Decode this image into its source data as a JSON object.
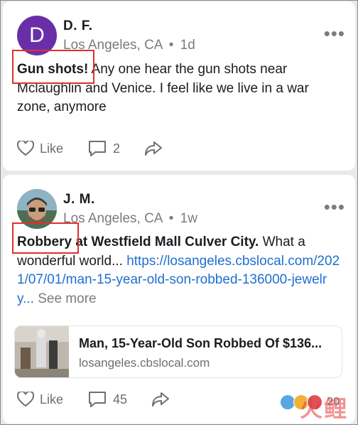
{
  "posts": [
    {
      "author": "D. F.",
      "avatar_initial": "D",
      "avatar_color": "#6a2fa8",
      "location": "Los Angeles, CA",
      "separator": "•",
      "age": "1d",
      "highlight": "Gun shots!",
      "text": "Any one hear the gun shots near Mclaughlin and Venice. I feel like we live in a war zone, anymore",
      "like_label": "Like",
      "comment_count": "2"
    },
    {
      "author": "J. M.",
      "location": "Los Angeles, CA",
      "separator": "•",
      "age": "1w",
      "highlight": "Robbery",
      "headline_rest": "at Westfield Mall Culver City.",
      "text": "What a wonderful world...",
      "link": "https://losangeles.cbslocal.com/2021/07/01/man-15-year-old-son-robbed-136000-jewelry...",
      "see_more": "See more",
      "preview_title": "Man, 15-Year-Old Son Robbed Of $136...",
      "preview_domain": "losangeles.cbslocal.com",
      "like_label": "Like",
      "comment_count": "45",
      "reaction_count": "20"
    }
  ],
  "icons": {
    "more": "more-horizontal-icon",
    "like": "heart-outline-icon",
    "comment": "comment-bubble-icon",
    "share": "share-arrow-icon"
  },
  "colors": {
    "highlight_box": "#e03030",
    "link": "#1e6fd0",
    "muted": "#7b7b80"
  },
  "watermark": "火鲤"
}
